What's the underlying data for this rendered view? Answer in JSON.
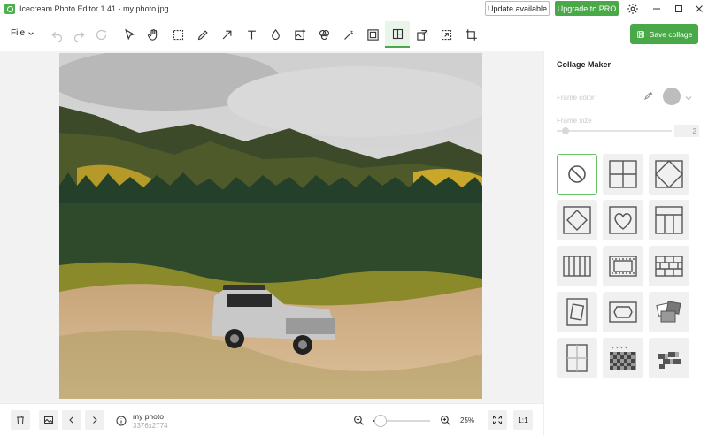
{
  "window": {
    "title": "Icecream Photo Editor 1.41 - my photo.jpg",
    "update_label": "Update available",
    "upgrade_label": "Upgrade to PRO",
    "brand_color": "#49a948"
  },
  "toolbar": {
    "file_label": "File",
    "tools": [
      "undo-icon",
      "redo-icon",
      "reset-icon",
      "select-icon",
      "hand-icon",
      "crop-select-icon",
      "pencil-icon",
      "arrow-icon",
      "text-icon",
      "fill-icon",
      "add-image-icon",
      "filters-icon",
      "magic-wand-icon",
      "frame-icon",
      "collage-icon",
      "export-icon",
      "resize-icon",
      "crop-icon"
    ],
    "active_tool": "collage-icon",
    "save_label": "Save collage"
  },
  "panel": {
    "title": "Collage Maker",
    "frame_color_label": "Frame color",
    "frame_color": "#bdbdbd",
    "frame_size_label": "Frame size",
    "frame_size_value": "2",
    "layouts": [
      "no-layout",
      "grid-2x2",
      "diamond-corners",
      "diamond-center",
      "heart",
      "top-strip-3",
      "vertical-strips",
      "horizontal-tiles",
      "brick-grid",
      "rotated-frame",
      "center-frame",
      "tilted-photos",
      "split-vertical",
      "checker-diagonal",
      "checker-scatter"
    ],
    "selected_layout": "no-layout"
  },
  "status": {
    "file_name": "my photo",
    "file_dims": "3376x2774",
    "zoom_label": "25%",
    "zoom_level": 0.12,
    "actual_size_label": "1:1"
  }
}
